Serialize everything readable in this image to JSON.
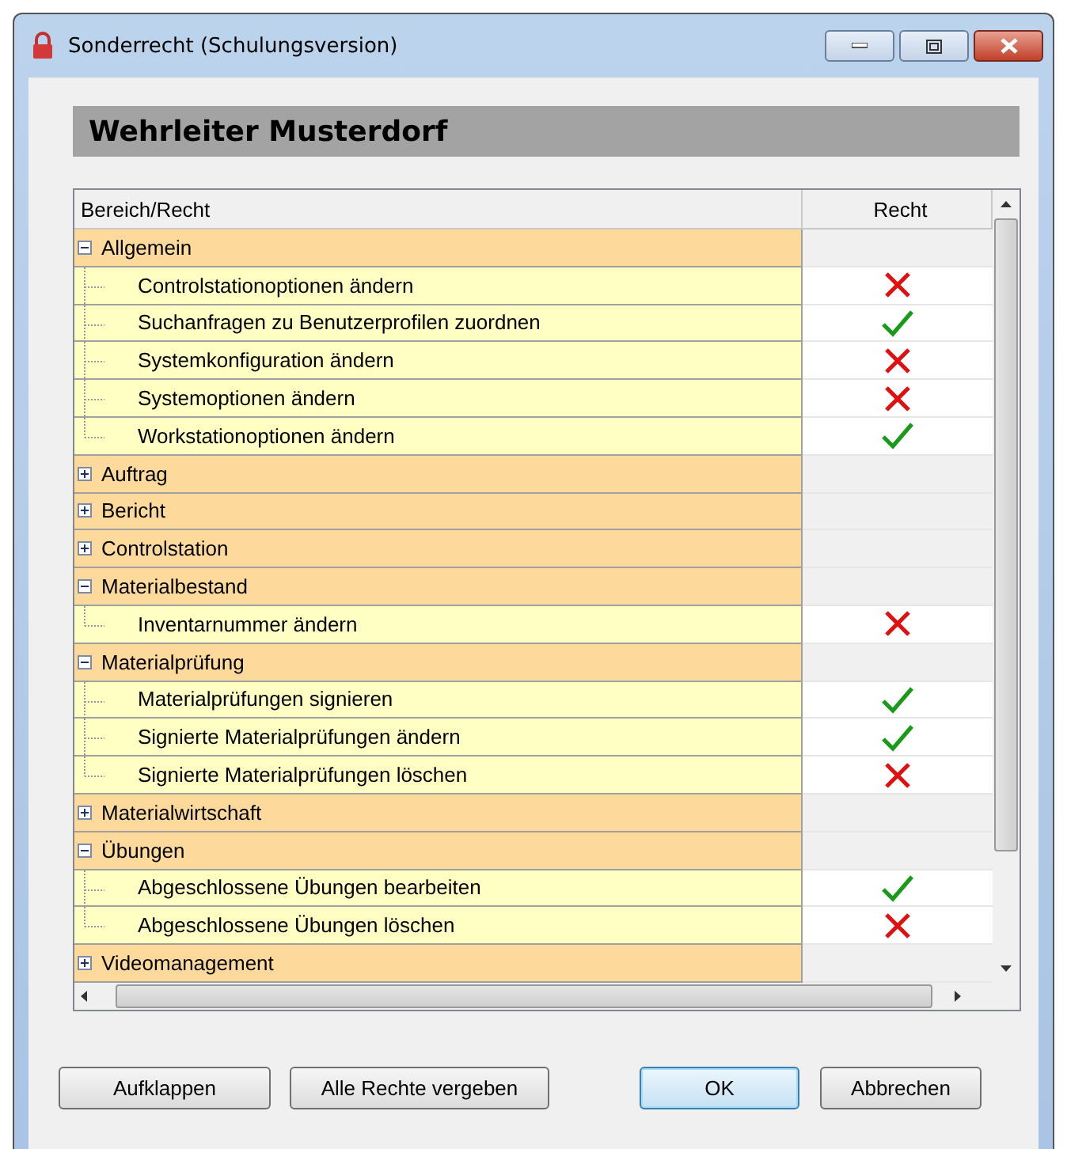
{
  "window": {
    "title": "Sonderrecht (Schulungsversion)"
  },
  "heading": "Wehrleiter Musterdorf",
  "table": {
    "columns": [
      "Bereich/Recht",
      "Recht"
    ],
    "groups": [
      {
        "label": "Allgemein",
        "expanded": true,
        "children": [
          {
            "label": "Controlstationoptionen ändern",
            "granted": false
          },
          {
            "label": "Suchanfragen zu Benutzerprofilen zuordnen",
            "granted": true
          },
          {
            "label": "Systemkonfiguration ändern",
            "granted": false
          },
          {
            "label": "Systemoptionen ändern",
            "granted": false
          },
          {
            "label": "Workstationoptionen ändern",
            "granted": true
          }
        ]
      },
      {
        "label": "Auftrag",
        "expanded": false
      },
      {
        "label": "Bericht",
        "expanded": false
      },
      {
        "label": "Controlstation",
        "expanded": false
      },
      {
        "label": "Materialbestand",
        "expanded": true,
        "children": [
          {
            "label": "Inventarnummer ändern",
            "granted": false
          }
        ]
      },
      {
        "label": "Materialprüfung",
        "expanded": true,
        "children": [
          {
            "label": "Materialprüfungen signieren",
            "granted": true
          },
          {
            "label": "Signierte Materialprüfungen ändern",
            "granted": true
          },
          {
            "label": "Signierte Materialprüfungen löschen",
            "granted": false
          }
        ]
      },
      {
        "label": "Materialwirtschaft",
        "expanded": false
      },
      {
        "label": "Übungen",
        "expanded": true,
        "children": [
          {
            "label": "Abgeschlossene Übungen bearbeiten",
            "granted": true
          },
          {
            "label": "Abgeschlossene Übungen löschen",
            "granted": false
          }
        ]
      },
      {
        "label": "Videomanagement",
        "expanded": false
      }
    ]
  },
  "buttons": [
    {
      "label": "Aufklappen",
      "default": false
    },
    {
      "label": "Alle Rechte vergeben",
      "default": false
    },
    {
      "label": "OK",
      "default": true
    },
    {
      "label": "Abbrechen",
      "default": false
    }
  ]
}
